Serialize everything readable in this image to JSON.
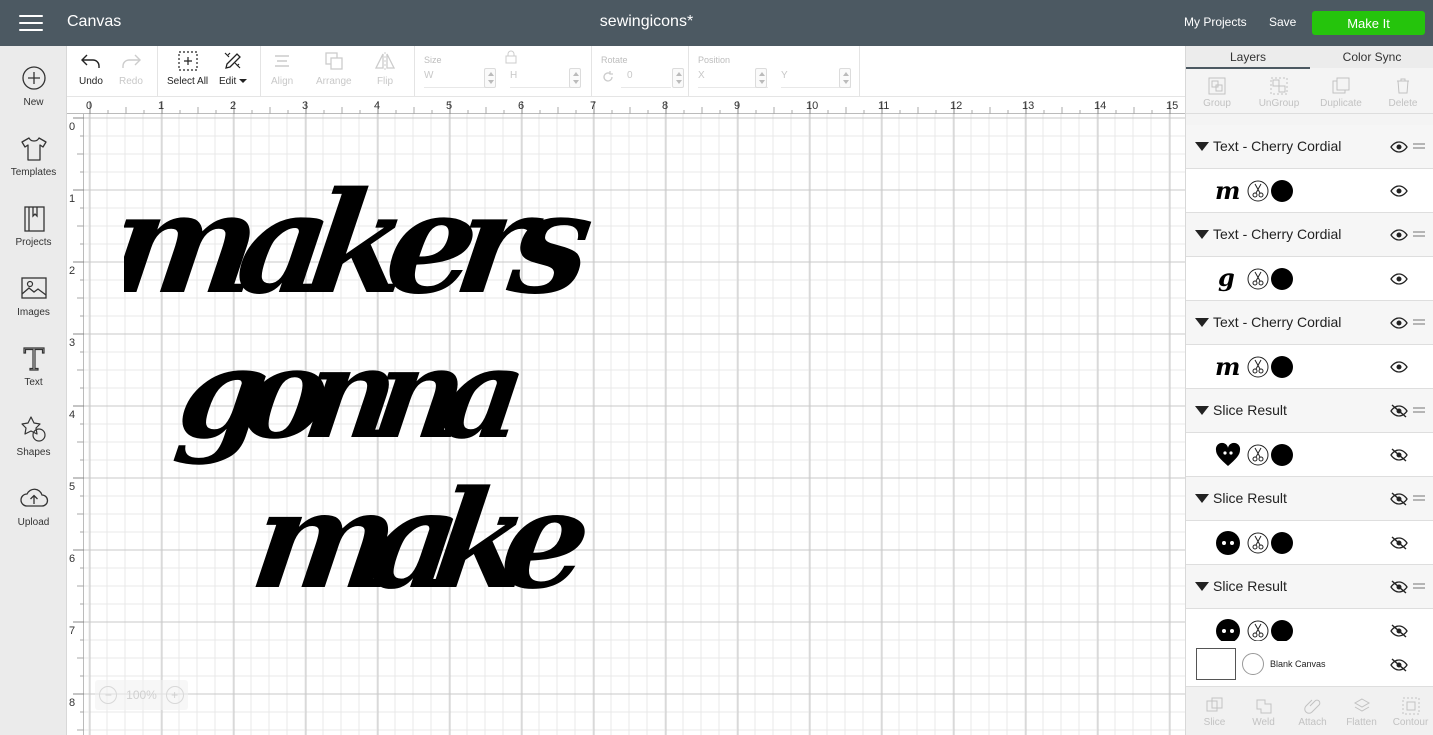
{
  "header": {
    "app_title": "Canvas",
    "document_title": "sewingicons*",
    "my_projects": "My Projects",
    "save": "Save",
    "make_it": "Make It",
    "make_it_color": "#25c40c",
    "bar_color": "#4c5962"
  },
  "sidebar": {
    "items": [
      {
        "label": "New",
        "icon": "plus-circle-icon"
      },
      {
        "label": "Templates",
        "icon": "tshirt-icon"
      },
      {
        "label": "Projects",
        "icon": "notebook-icon"
      },
      {
        "label": "Images",
        "icon": "image-icon"
      },
      {
        "label": "Text",
        "icon": "text-t-icon"
      },
      {
        "label": "Shapes",
        "icon": "shapes-icon"
      },
      {
        "label": "Upload",
        "icon": "cloud-upload-icon"
      }
    ]
  },
  "toolbar": {
    "undo": "Undo",
    "redo": "Redo",
    "select_all": "Select All",
    "edit": "Edit",
    "align": "Align",
    "arrange": "Arrange",
    "flip": "Flip",
    "size_label": "Size",
    "w_label": "W",
    "h_label": "H",
    "rotate_label": "Rotate",
    "rotate_value": "0",
    "position_label": "Position",
    "x_label": "X",
    "y_label": "Y"
  },
  "canvas": {
    "ruler_top": [
      "0",
      "1",
      "2",
      "3",
      "4",
      "5",
      "6",
      "7",
      "8",
      "9",
      "10",
      "11",
      "12",
      "13",
      "14",
      "15"
    ],
    "ruler_left": [
      "0",
      "1",
      "2",
      "3",
      "4",
      "5",
      "6",
      "7",
      "8"
    ],
    "design_lines": [
      "makers",
      "gonna",
      "make"
    ],
    "zoom": "100%"
  },
  "layers_panel": {
    "tabs": {
      "layers": "Layers",
      "color_sync": "Color Sync"
    },
    "tools": [
      "Group",
      "UnGroup",
      "Duplicate",
      "Delete"
    ],
    "groups": [
      {
        "name": "Text - Cherry Cordial",
        "thumb": "m",
        "visible": true
      },
      {
        "name": "Text - Cherry Cordial",
        "thumb": "g",
        "visible": true
      },
      {
        "name": "Text - Cherry Cordial",
        "thumb": "m",
        "visible": true
      },
      {
        "name": "Slice Result",
        "thumb": "heart-button-icon",
        "visible": false
      },
      {
        "name": "Slice Result",
        "thumb": "button-icon",
        "visible": false
      },
      {
        "name": "Slice Result",
        "thumb": "button-icon",
        "visible": false
      }
    ],
    "blank_canvas": "Blank Canvas",
    "bottom_tools": [
      "Slice",
      "Weld",
      "Attach",
      "Flatten",
      "Contour"
    ]
  }
}
